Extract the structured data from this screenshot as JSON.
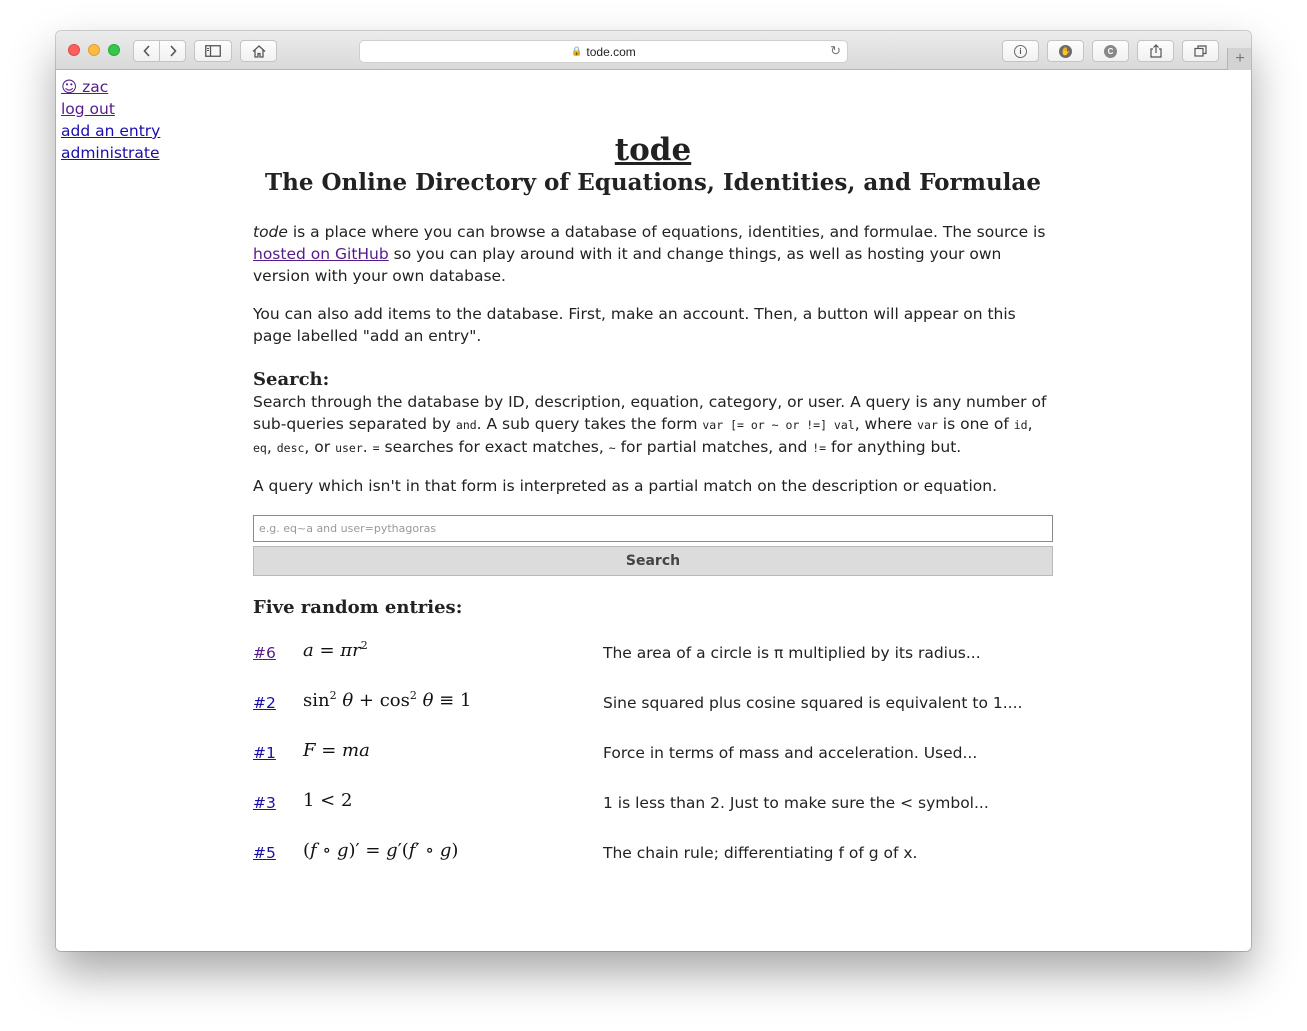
{
  "browser": {
    "url": "tode.com"
  },
  "sidebar": {
    "user": "☺ zac",
    "logout": "log out",
    "add_entry": "add an entry",
    "administrate": "administrate"
  },
  "header": {
    "title": "tode",
    "subtitle": "The Online Directory of Equations, Identities, and Formulae"
  },
  "intro": {
    "em": "tode",
    "text1": " is a place where you can browse a database of equations, identities, and formulae. The source is ",
    "github_link": "hosted on GitHub",
    "text2": " so you can play around with it and change things, as well as hosting your own version with your own database.",
    "para2": "You can also add items to the database. First, make an account. Then, a button will appear on this page labelled \"add an entry\"."
  },
  "search": {
    "heading": "Search:",
    "t1": "Search through the database by ID, description, equation, category, or user. A query is any number of sub-queries separated by ",
    "c_and": "and",
    "t2": ". A sub query takes the form ",
    "c_form": "var [= or ~ or !=] val",
    "t3": ", where ",
    "c_var": "var",
    "t4": " is one of ",
    "c_id": "id",
    "t5": ", ",
    "c_eq": "eq",
    "t6": ", ",
    "c_desc": "desc",
    "t7": ", or ",
    "c_user": "user",
    "t8": ". ",
    "c_equals": "=",
    "t9": " searches for exact matches, ",
    "c_tilde": "~",
    "t10": " for partial matches, and ",
    "c_ne": "!=",
    "t11": " for anything but.",
    "para2": "A query which isn't in that form is interpreted as a partial match on the description or equation.",
    "placeholder": "e.g. eq~a and user=pythagoras",
    "button": "Search"
  },
  "random": {
    "heading": "Five random entries:",
    "entries": [
      {
        "id": "#6",
        "desc": "The area of a circle is π multiplied by its radius..."
      },
      {
        "id": "#2",
        "desc": "Sine squared plus cosine squared is equivalent to 1...."
      },
      {
        "id": "#1",
        "desc": "Force in terms of mass and acceleration. Used..."
      },
      {
        "id": "#3",
        "desc": "1 is less than 2. Just to make sure the  <  symbol..."
      },
      {
        "id": "#5",
        "desc": "The chain rule; differentiating f of g of x."
      }
    ]
  },
  "icons": [
    "back-icon",
    "forward-icon",
    "sidebar-icon",
    "home-icon",
    "lock-icon",
    "reload-icon",
    "info-icon",
    "shield-icon",
    "c-icon",
    "share-icon",
    "tabs-icon",
    "plus-icon"
  ]
}
